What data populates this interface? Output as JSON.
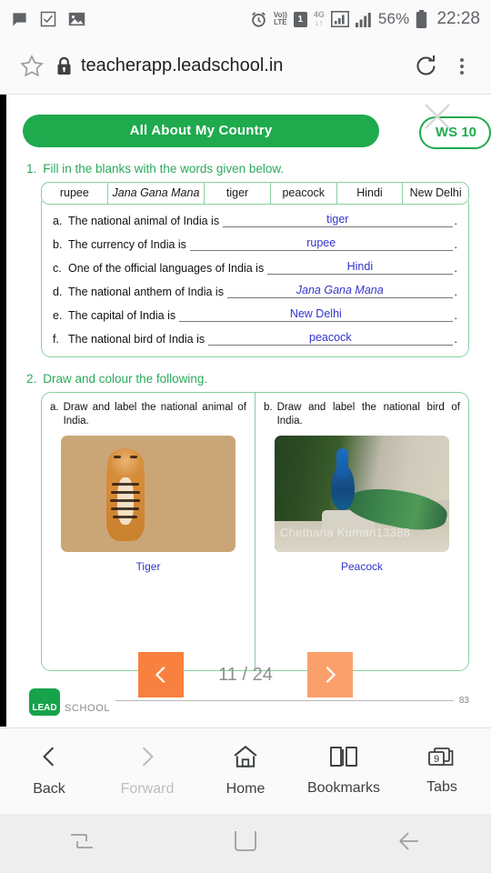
{
  "status_bar": {
    "left_icons": [
      "message-icon",
      "checkbox-icon",
      "image-icon"
    ],
    "alarm_icon": "alarm-icon",
    "volte_line1": "Vo))",
    "volte_line2": "LTE",
    "sim": "1",
    "network": "4G",
    "battery_percent": "56%",
    "time": "22:28"
  },
  "browser": {
    "url": "teacherapp.leadschool.in",
    "star_icon": "bookmark-star-icon",
    "lock_icon": "lock-icon",
    "reload_icon": "reload-icon",
    "menu_icon": "overflow-menu-icon",
    "bottom_bar": [
      {
        "label": "Back",
        "icon": "chevron-left-icon",
        "enabled": true
      },
      {
        "label": "Forward",
        "icon": "chevron-right-icon",
        "enabled": false
      },
      {
        "label": "Home",
        "icon": "home-icon",
        "enabled": true
      },
      {
        "label": "Bookmarks",
        "icon": "book-icon",
        "enabled": true
      },
      {
        "label": "Tabs",
        "icon": "tabs-icon",
        "enabled": true,
        "count": "9"
      }
    ]
  },
  "worksheet": {
    "title": "All About My Country",
    "ws_badge": "WS 10",
    "close_icon": "close-x-icon",
    "accent_green": "#1faa4e",
    "answer_blue": "#3333cc",
    "q1": {
      "number": "1.",
      "instruction": "Fill in the blanks with the words given below.",
      "wordbank": [
        {
          "word": "rupee",
          "italic": false
        },
        {
          "word": "Jana Gana Mana",
          "italic": true
        },
        {
          "word": "tiger",
          "italic": false
        },
        {
          "word": "peacock",
          "italic": false
        },
        {
          "word": "Hindi",
          "italic": false
        },
        {
          "word": "New Delhi",
          "italic": false
        }
      ],
      "blanks": [
        {
          "letter": "a.",
          "text": "The national animal of India is",
          "answer": "tiger",
          "italic": false
        },
        {
          "letter": "b.",
          "text": "The currency of India is",
          "answer": "rupee",
          "italic": false
        },
        {
          "letter": "c.",
          "text": "One of the official languages of India is",
          "answer": "Hindi",
          "italic": false
        },
        {
          "letter": "d.",
          "text": "The national anthem of India is",
          "answer": "Jana Gana Mana",
          "italic": true
        },
        {
          "letter": "e.",
          "text": "The capital of India is",
          "answer": "New Delhi",
          "italic": false
        },
        {
          "letter": "f.",
          "text": "The national bird of India is",
          "answer": "peacock",
          "italic": false
        }
      ]
    },
    "q2": {
      "number": "2.",
      "instruction": "Draw and colour the following.",
      "items": [
        {
          "letter": "a.",
          "prompt": "Draw and label the national animal of India.",
          "photo": "tiger-photo",
          "label": "Tiger"
        },
        {
          "letter": "b.",
          "prompt": "Draw and label the national bird of India.",
          "photo": "peacock-photo",
          "label": "Peacock",
          "watermark": "Chethana Kumari13388"
        }
      ]
    },
    "footer": {
      "logo_mark": "LEAD",
      "logo_word": "SCHOOL",
      "page_number": "83"
    },
    "pager": {
      "prev_icon": "chevron-left-icon",
      "next_icon": "chevron-right-icon",
      "counter": "11 / 24"
    }
  },
  "android_nav": {
    "recents_icon": "recents-icon",
    "home_icon": "home-square-icon",
    "back_icon": "back-arrow-icon"
  }
}
